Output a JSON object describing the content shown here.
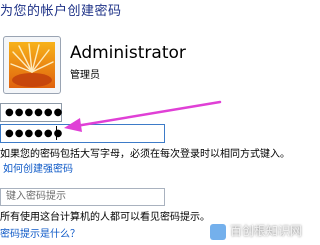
{
  "header": {
    "title": "为您的帐户创建密码"
  },
  "account": {
    "name": "Administrator",
    "role": "管理员"
  },
  "password": {
    "value": "●●●●●●"
  },
  "confirm_password": {
    "value": "●●●●●●"
  },
  "caps_note": "如果您的密码包括大写字母，必须在每次登录时以相同方式键入。",
  "strong_password_link": "如何创建强密码",
  "hint": {
    "placeholder": "键入密码提示"
  },
  "hint_note": "所有使用这台计算机的人都可以看见密码提示。",
  "hint_link": "密码提示是什么？",
  "watermark": {
    "text": "百创根知识网"
  },
  "colors": {
    "accent": "#1e3287",
    "link": "#0c58c7",
    "arrow": "#e040d6"
  }
}
